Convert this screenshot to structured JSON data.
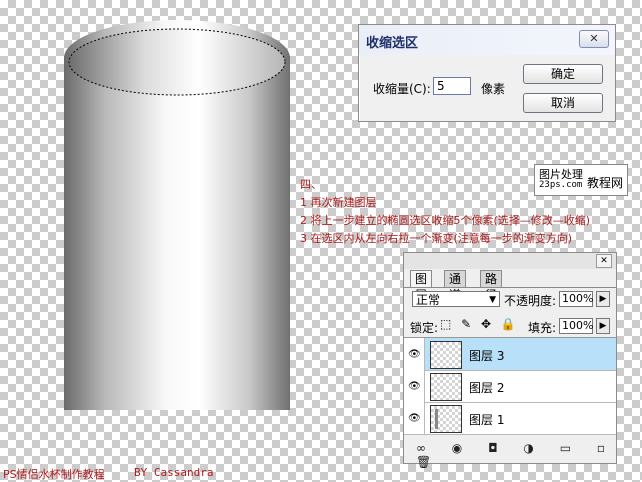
{
  "dialog": {
    "title": "收缩选区",
    "close_label": "✕",
    "shrink_label": "收缩量(C):",
    "shrink_value": "5",
    "unit": "像素",
    "ok_label": "确定",
    "cancel_label": "取消"
  },
  "watermark": {
    "line1": "图片处理",
    "line2": "23ps.com",
    "line3": "教程网"
  },
  "instructions": [
    "四、",
    "1 再次新建图层",
    "2 将上一步建立的椭圆选区收缩5个像素(选择—修改—收缩)",
    "3 在选区内从左向右拉一个渐变(注意每一步的渐变方向)"
  ],
  "layers_panel": {
    "close_label": "✕",
    "tabs": [
      "图层",
      "通道",
      "路径"
    ],
    "blend_mode": "正常",
    "opacity_label": "不透明度:",
    "opacity_value": "100%",
    "lock_label": "锁定:",
    "lock_icons": "⬚ ✎ ✥ 🔒",
    "fill_label": "填充:",
    "fill_value": "100%",
    "layers": [
      {
        "name": "图层 3",
        "selected": true
      },
      {
        "name": "图层 2",
        "selected": false
      },
      {
        "name": "图层 1",
        "selected": false
      }
    ],
    "footer_icons": "∞ ◉ ◘ ◑ ▭ ▫ 🗑"
  },
  "footer": {
    "left": "PS情侣水杯制作教程",
    "right": "BY Cassandra"
  },
  "colors": {
    "instruction_red": "#b01a1a",
    "selected_layer": "#b8e0f8"
  }
}
